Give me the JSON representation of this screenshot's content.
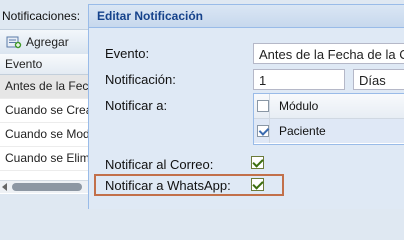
{
  "background": {
    "title": "Notificaciones:",
    "toolbar": {
      "add_label": "Agregar"
    },
    "grid": {
      "column_header": "Evento",
      "rows": [
        "Antes de la Fech",
        "Cuando se Crea",
        "Cuando se Modi",
        "Cuando se Elimi"
      ]
    }
  },
  "dialog": {
    "title": "Editar Notificación",
    "evento_label": "Evento:",
    "evento_value": "Antes de la Fecha de la Cita",
    "notificacion_label": "Notificación:",
    "notificacion_value": "1",
    "unit_value": "Días",
    "notificar_a_label": "Notificar a:",
    "options": [
      {
        "label": "Módulo",
        "checked": false
      },
      {
        "label": "Paciente",
        "checked": true
      }
    ],
    "correo_label": "Notificar al Correo:",
    "correo_checked": true,
    "whatsapp_label": "Notificar a WhatsApp:",
    "whatsapp_checked": true
  },
  "colors": {
    "highlight": "#c2704a",
    "header_text": "#15428b",
    "check_green": "#3c6f10"
  }
}
